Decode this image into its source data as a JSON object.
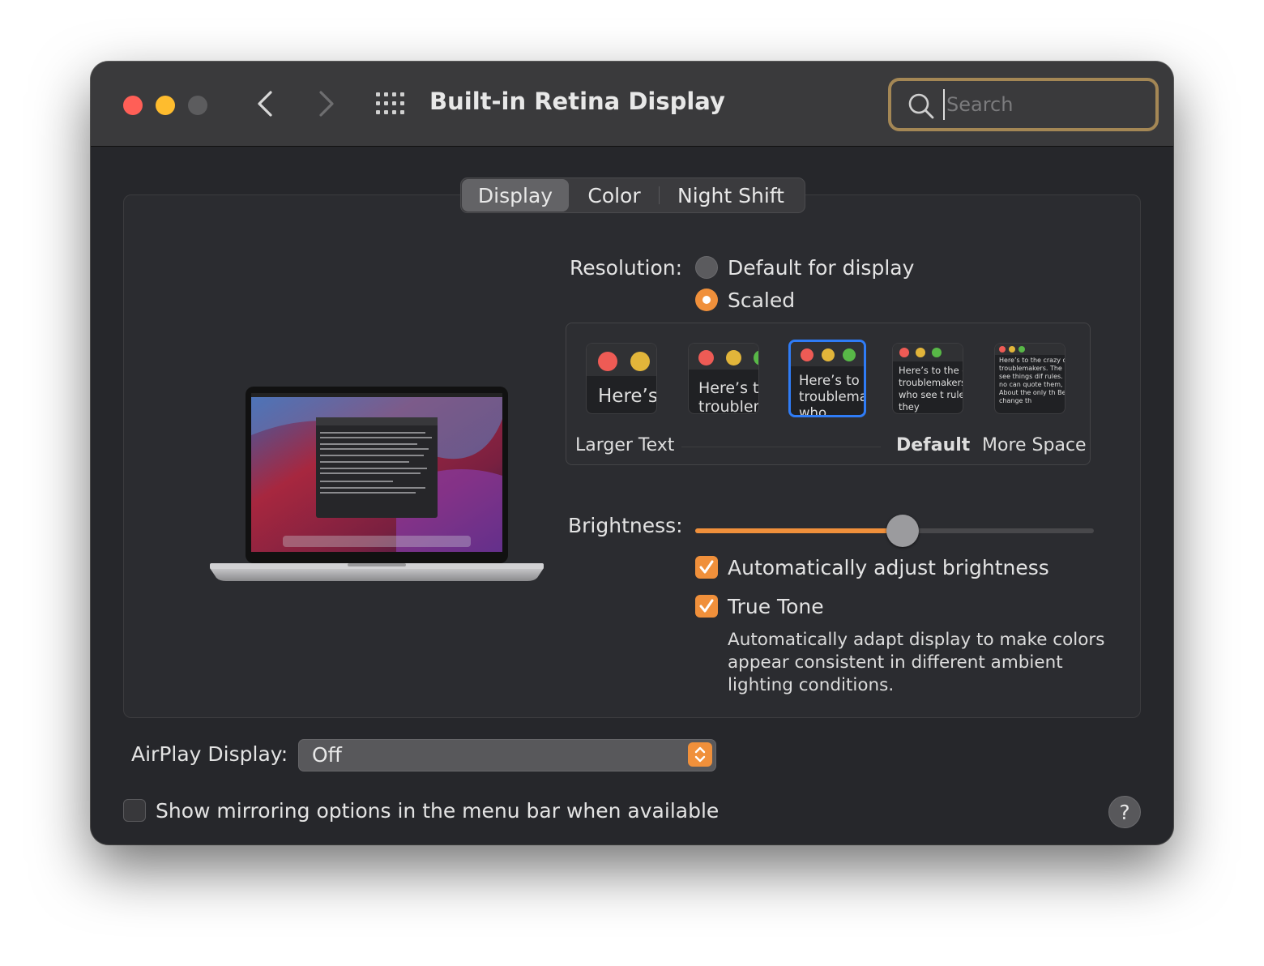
{
  "window": {
    "title": "Built-in Retina Display",
    "search_placeholder": "Search"
  },
  "tabs": [
    {
      "label": "Display",
      "active": true
    },
    {
      "label": "Color",
      "active": false
    },
    {
      "label": "Night Shift",
      "active": false
    }
  ],
  "resolution": {
    "label": "Resolution:",
    "options": [
      {
        "label": "Default for display",
        "selected": false
      },
      {
        "label": "Scaled",
        "selected": true
      }
    ],
    "scaled_options": [
      {
        "sample": "Here’s",
        "selected": false
      },
      {
        "sample": "Here’s to troublem",
        "selected": false
      },
      {
        "sample": "Here’s to t troublema ones who",
        "selected": true
      },
      {
        "sample": "Here’s to the cr troublemakers. ones who see t rules. And they",
        "selected": false
      },
      {
        "sample": "Here’s to the crazy one troublemakers. The rou ones who see things dif rules. And they have no can quote them, disagr them. About the only th Because they change th",
        "selected": false
      }
    ],
    "scale_labels": {
      "larger": "Larger Text",
      "default": "Default",
      "more": "More Space"
    }
  },
  "brightness": {
    "label": "Brightness:",
    "level": 0.52,
    "auto_adjust": {
      "label": "Automatically adjust brightness",
      "checked": true
    }
  },
  "true_tone": {
    "label": "True Tone",
    "checked": true,
    "description": "Automatically adapt display to make colors appear consistent in different ambient lighting conditions."
  },
  "airplay": {
    "label": "AirPlay Display:",
    "value": "Off"
  },
  "mirroring": {
    "label": "Show mirroring options in the menu bar when available",
    "checked": false
  },
  "help": {
    "label": "?"
  },
  "colors": {
    "accent": "#f0903b",
    "selection": "#2f7cf6",
    "search_focus": "#a48755",
    "close": "#ff5f57",
    "minimize": "#febc2e"
  },
  "icons": [
    "close-icon",
    "minimize-icon",
    "zoom-icon",
    "back-chevron-icon",
    "forward-chevron-icon",
    "grid-icon",
    "search-icon",
    "checkmark-icon",
    "updown-arrows-icon",
    "help-icon"
  ]
}
